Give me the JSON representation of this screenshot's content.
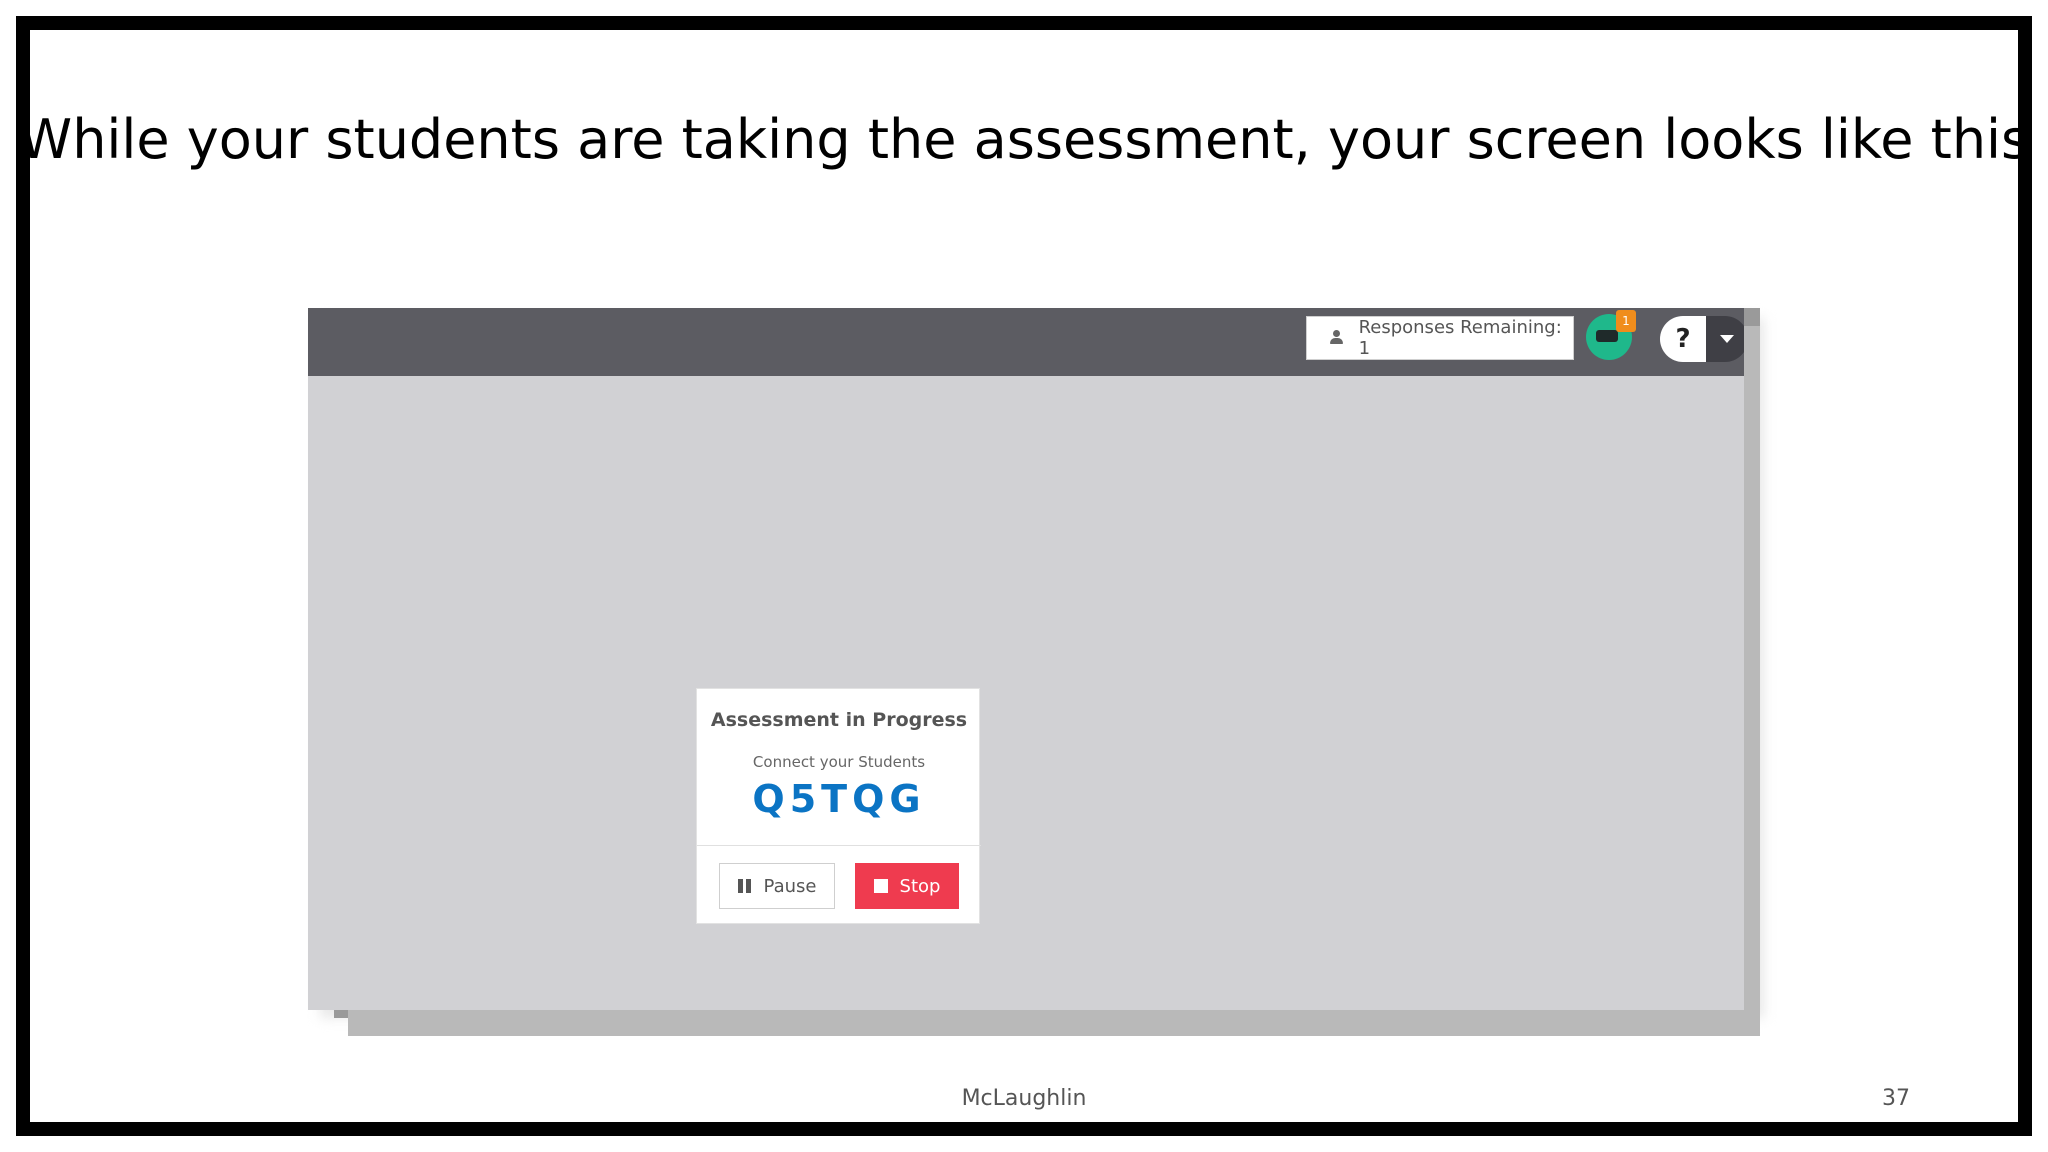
{
  "slide": {
    "title": "While your students are taking the assessment, your screen looks like this",
    "footer_author": "McLaughlin",
    "page_number": "37"
  },
  "app": {
    "responses_label": "Responses Remaining: 1",
    "avatar_badge": "1",
    "help_label": "?",
    "card": {
      "title": "Assessment in Progress",
      "subtitle": "Connect your Students",
      "code": "Q5TQG",
      "pause_label": "Pause",
      "stop_label": "Stop"
    }
  },
  "colors": {
    "topbar": "#5c5c62",
    "canvas": "#d1d1d4",
    "code": "#0b74c4",
    "stop": "#ef3b4f",
    "avatar": "#1fb88b",
    "badge": "#f08d1c"
  }
}
